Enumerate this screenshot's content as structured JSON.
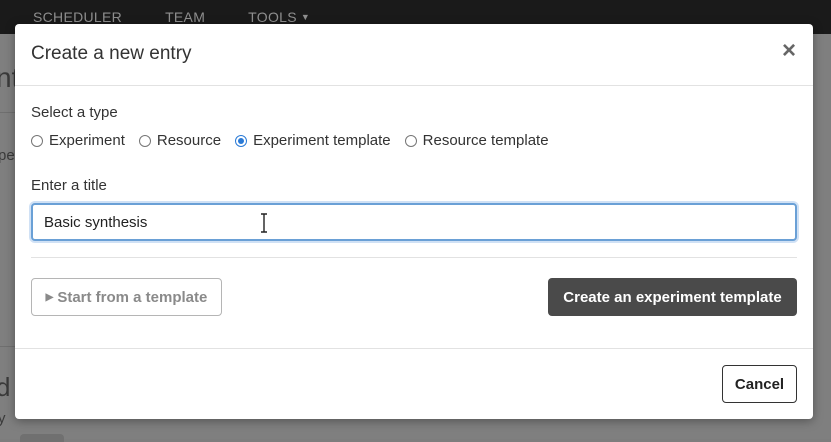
{
  "nav": {
    "items": [
      "SCHEDULER",
      "TEAM",
      "TOOLS"
    ]
  },
  "background": {
    "fragment_heading": "nt",
    "fragment_text": "pe",
    "fragment_heading2": "d",
    "fragment_text2": "y"
  },
  "modal": {
    "title": "Create a new entry",
    "close_glyph": "×",
    "type_label": "Select a type",
    "types": [
      {
        "label": "Experiment",
        "checked": false
      },
      {
        "label": "Resource",
        "checked": false
      },
      {
        "label": "Experiment template",
        "checked": true
      },
      {
        "label": "Resource template",
        "checked": false
      }
    ],
    "title_label": "Enter a title",
    "title_value": "Basic synthesis",
    "template_button": "Start from a template",
    "create_button": "Create an experiment template",
    "cancel_button": "Cancel"
  },
  "colors": {
    "accent": "#2a7ad6",
    "primary_button": "#4a4a4a",
    "navbar": "#1a1a1a"
  }
}
